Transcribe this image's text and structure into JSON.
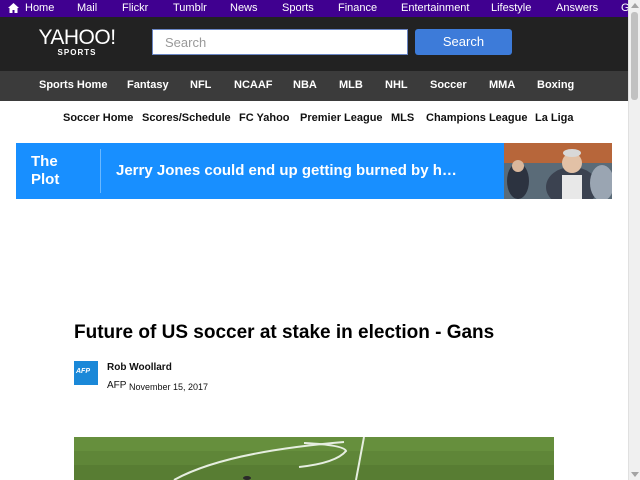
{
  "top_nav": {
    "items": [
      "Home",
      "Mail",
      "Flickr",
      "Tumblr",
      "News",
      "Sports",
      "Finance",
      "Entertainment",
      "Lifestyle",
      "Answers",
      "G"
    ]
  },
  "header": {
    "logo_main": "YAHOO!",
    "logo_sub": "SPORTS",
    "search_placeholder": "Search",
    "search_button": "Search"
  },
  "sports_nav": {
    "items": [
      "Sports Home",
      "Fantasy",
      "NFL",
      "NCAAF",
      "NBA",
      "MLB",
      "NHL",
      "Soccer",
      "MMA",
      "Boxing"
    ]
  },
  "soccer_nav": {
    "items": [
      "Soccer Home",
      "Scores/Schedule",
      "FC Yahoo",
      "Premier League",
      "MLS",
      "Champions League",
      "La Liga"
    ]
  },
  "banner": {
    "label_line1": "The",
    "label_line2": "Plot",
    "headline": "Jerry Jones could end up getting burned by h…"
  },
  "article": {
    "title": "Future of US soccer at stake in election - Gans",
    "provider_logo": "AFP",
    "author": "Rob Woollard",
    "provider": "AFP",
    "date": "November 15, 2017"
  },
  "colors": {
    "top_nav_bg": "#400090",
    "header_bg": "#222222",
    "sports_nav_bg": "#3b3b3b",
    "search_button": "#3d7bd9",
    "banner_bg": "#188fff"
  }
}
